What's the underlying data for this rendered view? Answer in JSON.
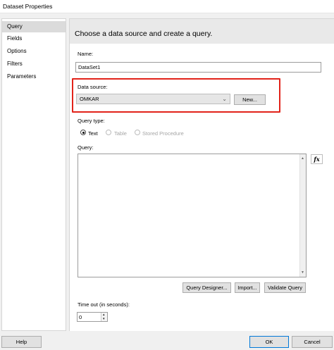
{
  "window": {
    "title": "Dataset Properties"
  },
  "nav": {
    "items": [
      "Query",
      "Fields",
      "Options",
      "Filters",
      "Parameters"
    ]
  },
  "header": {
    "text": "Choose a data source and create a query."
  },
  "name": {
    "label": "Name:",
    "value": "DataSet1"
  },
  "datasource": {
    "label": "Data source:",
    "value": "OMKAR",
    "new_label": "New..."
  },
  "query_type": {
    "label": "Query type:",
    "options": [
      "Text",
      "Table",
      "Stored Procedure"
    ],
    "selected": "Text"
  },
  "query": {
    "label": "Query:",
    "fx_label": "fx"
  },
  "buttons": {
    "designer": "Query Designer...",
    "import": "Import...",
    "validate": "Validate Query"
  },
  "timeout": {
    "label": "Time out (in seconds):",
    "value": "0"
  },
  "footer": {
    "help": "Help",
    "ok": "OK",
    "cancel": "Cancel"
  },
  "colors": {
    "highlight_border": "#e2231a",
    "primary_border": "#0078d7"
  }
}
